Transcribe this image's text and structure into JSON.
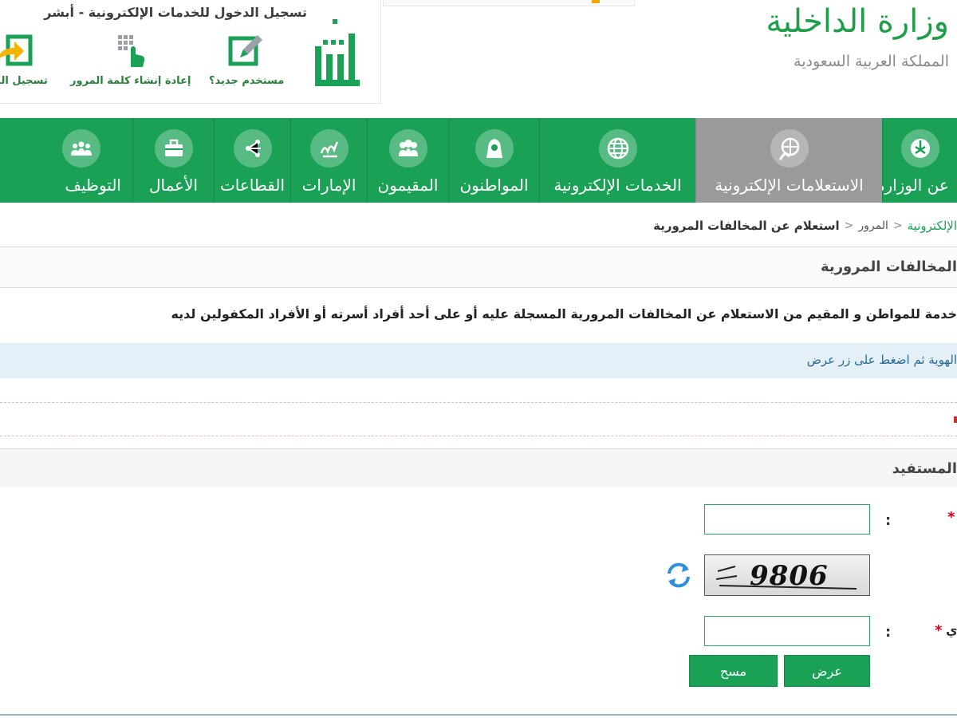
{
  "absher": {
    "title": "تسجيل الدخول للخدمات الإلكترونية - أبشر",
    "links": [
      {
        "label": "مستخدم جديد؟",
        "icon": "edit-icon"
      },
      {
        "label": "إعادة إنشاء كلمة المرور",
        "icon": "hand-keypad-icon"
      },
      {
        "label": "تسجيل الد",
        "icon": "login-arrow-icon"
      }
    ],
    "logo_text": "أبشر"
  },
  "ministry": {
    "name": "وزارة الداخلية",
    "subtitle": "المملكة العربية السعودية"
  },
  "nav": {
    "items": [
      {
        "label": "عن الوزارة",
        "icon": "emblem-icon",
        "active": false
      },
      {
        "label": "الاستعلامات الإلكترونية",
        "icon": "globe-hand-icon",
        "active": true
      },
      {
        "label": "الخدمات الإلكترونية",
        "icon": "globe-icon",
        "active": false
      },
      {
        "label": "المواطنون",
        "icon": "citizen-icon",
        "active": false
      },
      {
        "label": "المقيمون",
        "icon": "residents-icon",
        "active": false
      },
      {
        "label": "الإمارات",
        "icon": "calligraphy-icon",
        "active": false
      },
      {
        "label": "القطاعات",
        "icon": "share-nodes-icon",
        "active": false
      },
      {
        "label": "الأعمال",
        "icon": "briefcase-icon",
        "active": false
      },
      {
        "label": "التوظيف",
        "icon": "team-icon",
        "active": false
      }
    ]
  },
  "breadcrumb": {
    "first": "الإلكترونية",
    "middle": "المرور",
    "current": "استعلام عن المخالفات المرورية"
  },
  "panel": {
    "title": "المخالفات المرورية",
    "description": "خدمة للمواطن و المقيم من الاستعلام عن المخالفات المرورية المسجلة عليه أو على أحد أفراد أسرته أو الأفراد المكفولين لديه",
    "info": "الهوية ثم اضغط على زر عرض",
    "section_title": "المستفيد"
  },
  "form": {
    "field1_value": "",
    "field2_value": "",
    "colon": ":",
    "required_mark": "*",
    "field2_label_fragment": "ي",
    "captcha_text": "9806"
  },
  "buttons": {
    "show": "عرض",
    "clear": "مسح"
  },
  "colors": {
    "green": "#1aa155",
    "active_nav": "#9a9a9a",
    "info_bg": "#e4eff7"
  }
}
